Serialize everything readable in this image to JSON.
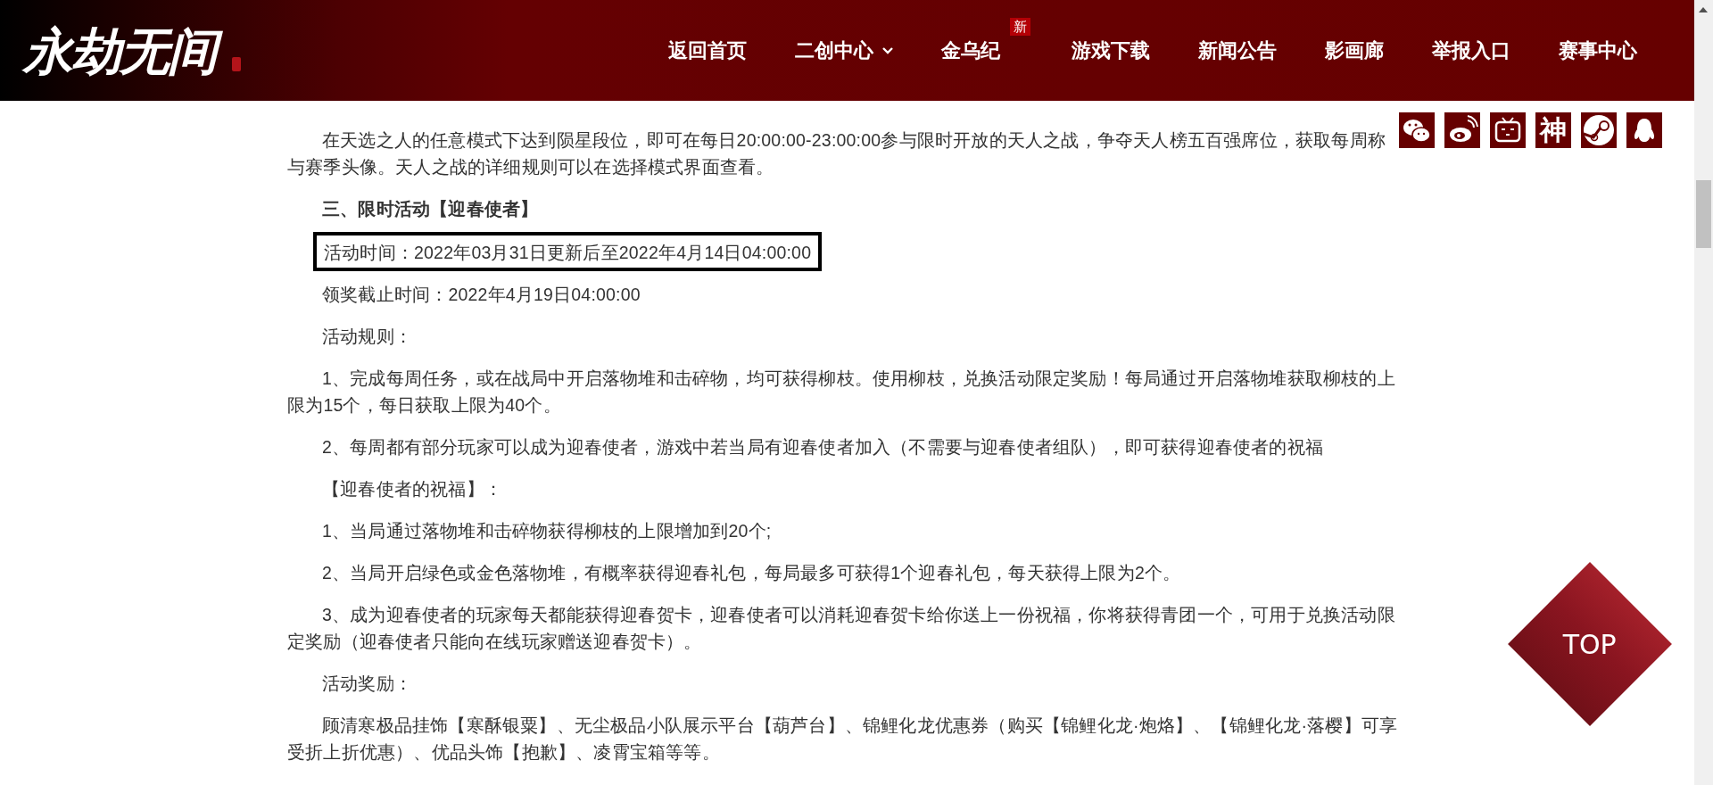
{
  "header": {
    "logo": "永劫无间",
    "nav": [
      {
        "label": "返回首页",
        "has_menu": false
      },
      {
        "label": "二创中心",
        "has_menu": true
      },
      {
        "label": "金乌纪",
        "has_menu": false,
        "badge": "新"
      },
      {
        "label": "游戏下载",
        "has_menu": false
      },
      {
        "label": "新闻公告",
        "has_menu": false
      },
      {
        "label": "影画廊",
        "has_menu": false
      },
      {
        "label": "举报入口",
        "has_menu": false
      },
      {
        "label": "赛事中心",
        "has_menu": false
      }
    ]
  },
  "social": [
    {
      "kind": "chat"
    },
    {
      "kind": "weibo"
    },
    {
      "kind": "tv"
    },
    {
      "kind": "glyph",
      "glyph": "神"
    },
    {
      "kind": "steam"
    },
    {
      "kind": "penguin"
    }
  ],
  "article": [
    {
      "kind": "lines",
      "lines": [
        "在天选之人的任意模式下达到陨星段位，即可在每日20:00:00-23:00:00参与限时开放的天人之战，争夺天人榜五百强席位，获取每周称",
        "与赛季头像。天人之战的详细规则可以在选择模式界面查看。"
      ]
    },
    {
      "kind": "heading",
      "text": "三、限时活动【迎春使者】"
    },
    {
      "kind": "boxed",
      "text": "活动时间：2022年03月31日更新后至2022年4月14日04:00:00"
    },
    {
      "kind": "text",
      "text": "领奖截止时间：2022年4月19日04:00:00"
    },
    {
      "kind": "text",
      "text": "活动规则："
    },
    {
      "kind": "text",
      "text": "1、完成每周任务，或在战局中开启落物堆和击碎物，均可获得柳枝。使用柳枝，兑换活动限定奖励！每局通过开启落物堆获取柳枝的上限为15个，每日获取上限为40个。"
    },
    {
      "kind": "text",
      "text": "2、每周都有部分玩家可以成为迎春使者，游戏中若当局有迎春使者加入（不需要与迎春使者组队），即可获得迎春使者的祝福"
    },
    {
      "kind": "text",
      "text": "【迎春使者的祝福】："
    },
    {
      "kind": "text",
      "text": "1、当局通过落物堆和击碎物获得柳枝的上限增加到20个;"
    },
    {
      "kind": "text",
      "text": "2、当局开启绿色或金色落物堆，有概率获得迎春礼包，每局最多可获得1个迎春礼包，每天获得上限为2个。"
    },
    {
      "kind": "text",
      "text": "3、成为迎春使者的玩家每天都能获得迎春贺卡，迎春使者可以消耗迎春贺卡给你送上一份祝福，你将获得青团一个，可用于兑换活动限定奖励（迎春使者只能向在线玩家赠送迎春贺卡）。"
    },
    {
      "kind": "text",
      "text": "活动奖励："
    },
    {
      "kind": "text",
      "text": "顾清寒极品挂饰【寒酥银粟】、无尘极品小队展示平台【葫芦台】、锦鲤化龙优惠券（购买【锦鲤化龙·炮烙】、【锦鲤化龙·落樱】可享受折上折优惠）、优品头饰【抱歉】、凌霄宝箱等等。"
    }
  ],
  "top_button": "TOP"
}
